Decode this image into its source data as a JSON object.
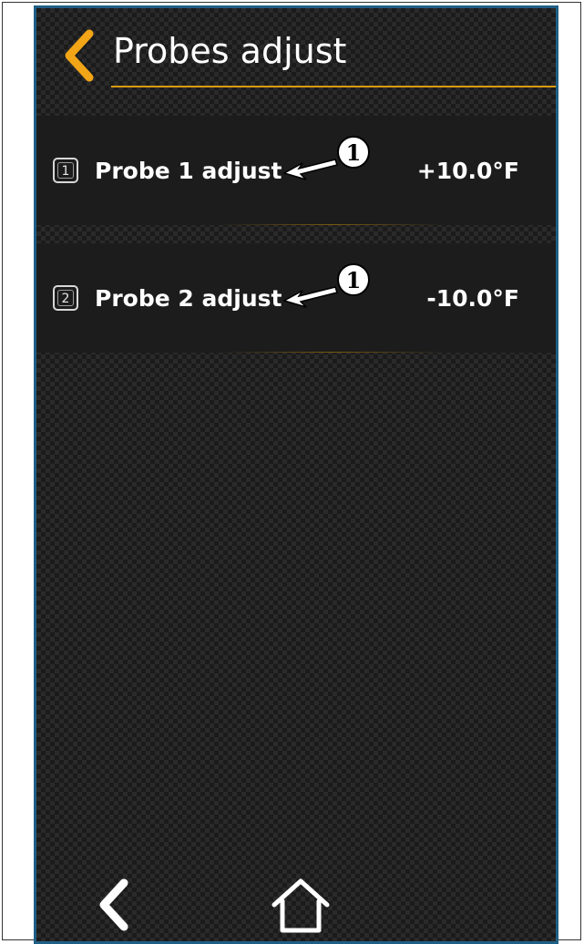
{
  "header": {
    "title": "Probes adjust",
    "back_icon": "chevron-left-icon",
    "accent_color": "#F2A516"
  },
  "probes": [
    {
      "index": "1",
      "label": "Probe 1 adjust",
      "value": "+10.0°F",
      "callout": "1"
    },
    {
      "index": "2",
      "label": "Probe 2 adjust",
      "value": "-10.0°F",
      "callout": "1"
    }
  ],
  "bottom_nav": {
    "back_icon": "chevron-left-icon",
    "home_icon": "home-icon"
  }
}
